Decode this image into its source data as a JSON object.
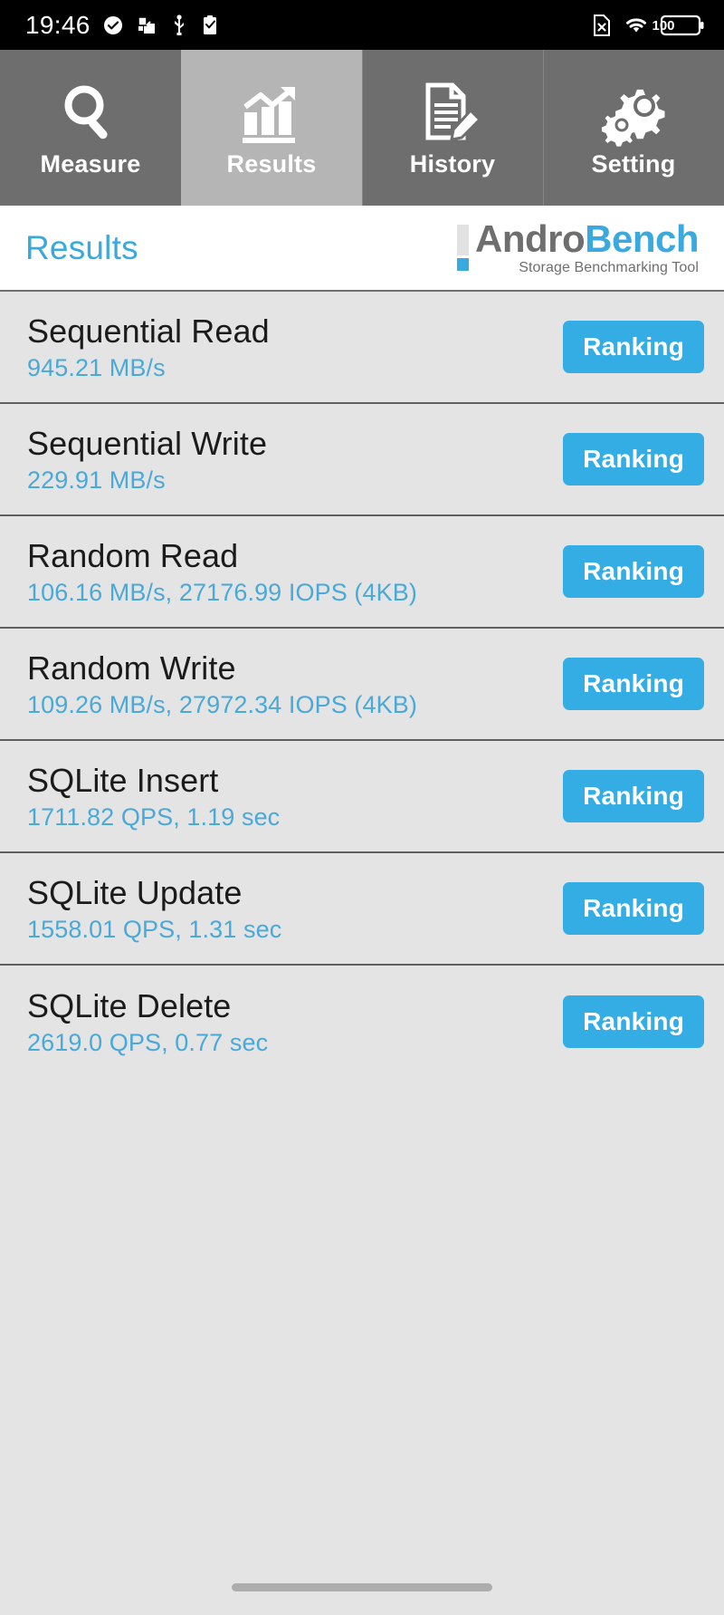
{
  "status_bar": {
    "clock": "19:46",
    "left_icons": [
      "check-circle-icon",
      "screenshot-icon",
      "usb-icon",
      "clipboard-check-icon"
    ],
    "right_icons": [
      "no-sim-icon",
      "wifi-icon"
    ],
    "battery_level": "100"
  },
  "tabs": [
    {
      "label": "Measure",
      "icon": "magnifier-icon",
      "active": false
    },
    {
      "label": "Results",
      "icon": "bar-chart-arrow-icon",
      "active": true
    },
    {
      "label": "History",
      "icon": "document-pencil-icon",
      "active": false
    },
    {
      "label": "Setting",
      "icon": "gears-icon",
      "active": false
    }
  ],
  "header": {
    "title": "Results",
    "brand_primary": "Andro",
    "brand_secondary": "Bench",
    "tagline": "Storage Benchmarking Tool"
  },
  "results": {
    "ranking_label": "Ranking",
    "rows": [
      {
        "name": "Sequential Read",
        "value": "945.21 MB/s"
      },
      {
        "name": "Sequential Write",
        "value": "229.91 MB/s"
      },
      {
        "name": "Random Read",
        "value": "106.16 MB/s, 27176.99 IOPS (4KB)"
      },
      {
        "name": "Random Write",
        "value": "109.26 MB/s, 27972.34 IOPS (4KB)"
      },
      {
        "name": "SQLite Insert",
        "value": "1711.82 QPS, 1.19 sec"
      },
      {
        "name": "SQLite Update",
        "value": "1558.01 QPS, 1.31 sec"
      },
      {
        "name": "SQLite Delete",
        "value": "2619.0 QPS, 0.77 sec"
      }
    ]
  },
  "colors": {
    "accent_blue": "#33ade4",
    "value_blue": "#49a9d8",
    "tab_inactive": "#6e6e6e",
    "tab_active": "#b5b5b5",
    "list_background": "#e4e4e4"
  }
}
